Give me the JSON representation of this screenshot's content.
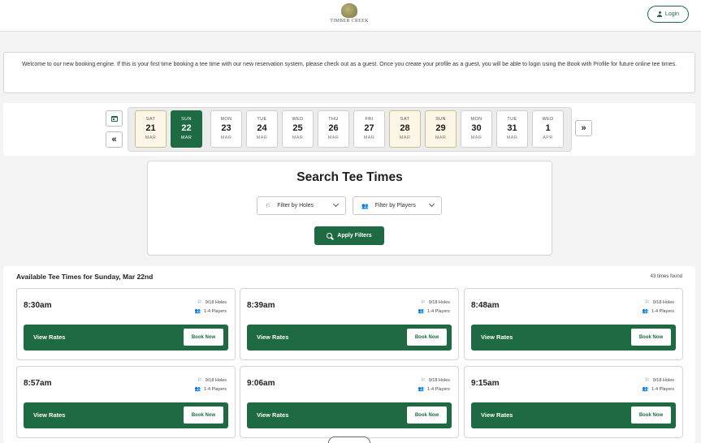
{
  "header": {
    "logo_text": "TIMBER CREEK",
    "login_label": "Login"
  },
  "welcome_message": "Welcome to our new booking engine.  If this is your first time booking a tee time with our new reservation system, please check out as a guest.  Once you create your profile as a guest, you will be able to login using the Book with Profile for future online tee times.",
  "date_nav": {
    "prev_label": "«",
    "next_label": "»",
    "days": [
      {
        "dow": "SAT",
        "num": "21",
        "mon": "MAR",
        "state": "weekend"
      },
      {
        "dow": "SUN",
        "num": "22",
        "mon": "MAR",
        "state": "selected"
      },
      {
        "dow": "MON",
        "num": "23",
        "mon": "MAR",
        "state": "normal"
      },
      {
        "dow": "TUE",
        "num": "24",
        "mon": "MAR",
        "state": "normal"
      },
      {
        "dow": "WED",
        "num": "25",
        "mon": "MAR",
        "state": "normal"
      },
      {
        "dow": "THU",
        "num": "26",
        "mon": "MAR",
        "state": "normal"
      },
      {
        "dow": "FRI",
        "num": "27",
        "mon": "MAR",
        "state": "normal"
      },
      {
        "dow": "SAT",
        "num": "28",
        "mon": "MAR",
        "state": "weekend"
      },
      {
        "dow": "SUN",
        "num": "29",
        "mon": "MAR",
        "state": "weekend"
      },
      {
        "dow": "MON",
        "num": "30",
        "mon": "MAR",
        "state": "normal"
      },
      {
        "dow": "TUE",
        "num": "31",
        "mon": "MAR",
        "state": "normal"
      },
      {
        "dow": "WED",
        "num": "1",
        "mon": "APR",
        "state": "normal"
      }
    ]
  },
  "search": {
    "title": "Search Tee Times",
    "holes_filter": "Filter by Holes",
    "players_filter": "Filter by Players",
    "apply_label": "Apply Filters"
  },
  "results": {
    "title": "Available Tee Times for Sunday, Mar 22nd",
    "count_text": "43 times found",
    "view_rates_label": "View Rates",
    "book_label": "Book Now",
    "tee_times": [
      {
        "time": "8:30am",
        "holes": "9/18 Holes",
        "players": "1-4 Players"
      },
      {
        "time": "8:39am",
        "holes": "9/18 Holes",
        "players": "1-4 Players"
      },
      {
        "time": "8:48am",
        "holes": "9/18 Holes",
        "players": "1-4 Players"
      },
      {
        "time": "8:57am",
        "holes": "9/18 Holes",
        "players": "1-4 Players"
      },
      {
        "time": "9:06am",
        "holes": "9/18 Holes",
        "players": "1-4 Players"
      },
      {
        "time": "9:15am",
        "holes": "9/18 Holes",
        "players": "1-4 Players"
      }
    ]
  },
  "colors": {
    "accent": "#1d6a43",
    "weekend_bg": "#fbf6e6"
  },
  "icons": {
    "holes": "flag-icon",
    "players": "players-icon",
    "calendar": "calendar-icon",
    "search": "search-icon",
    "user": "user-icon"
  }
}
